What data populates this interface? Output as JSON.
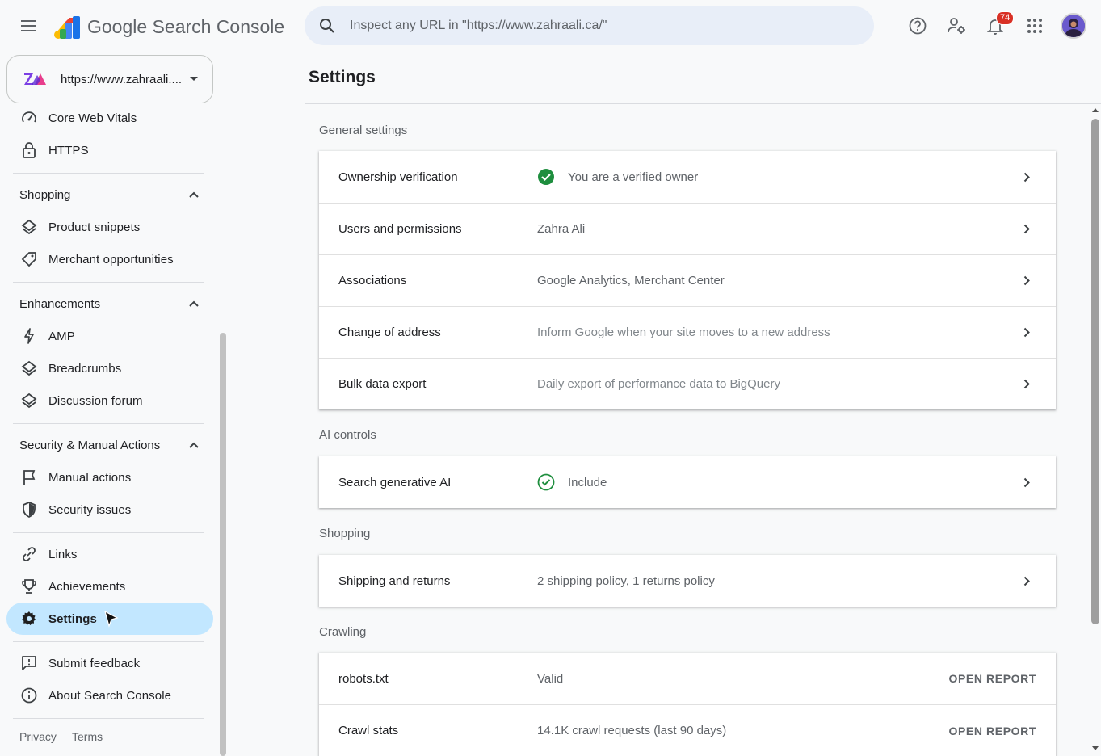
{
  "header": {
    "app_name": "Google Search Console",
    "search_placeholder": "Inspect any URL in \"https://www.zahraali.ca/\"",
    "notification_count": "74"
  },
  "property": {
    "url": "https://www.zahraali...."
  },
  "sidebar": {
    "items_top": [
      {
        "label": "Core Web Vitals",
        "icon": "gauge-icon"
      },
      {
        "label": "HTTPS",
        "icon": "lock-icon"
      }
    ],
    "sections": [
      {
        "title": "Shopping",
        "items": [
          "Product snippets",
          "Merchant opportunities"
        ]
      },
      {
        "title": "Enhancements",
        "items": [
          "AMP",
          "Breadcrumbs",
          "Discussion forum"
        ]
      },
      {
        "title": "Security & Manual Actions",
        "items": [
          "Manual actions",
          "Security issues"
        ]
      }
    ],
    "items_bottom": [
      "Links",
      "Achievements",
      "Settings"
    ],
    "active_item": "Settings",
    "footer_items": [
      "Submit feedback",
      "About Search Console"
    ],
    "footer_links": {
      "privacy": "Privacy",
      "terms": "Terms"
    }
  },
  "main": {
    "title": "Settings",
    "groups": [
      {
        "label": "General settings",
        "rows": [
          {
            "label": "Ownership verification",
            "value": "You are a verified owner",
            "icon": "verified-check-icon"
          },
          {
            "label": "Users and permissions",
            "value": "Zahra Ali"
          },
          {
            "label": "Associations",
            "value": "Google Analytics, Merchant Center"
          },
          {
            "label": "Change of address",
            "value": "Inform Google when your site moves to a new address"
          },
          {
            "label": "Bulk data export",
            "value": "Daily export of performance data to BigQuery"
          }
        ]
      },
      {
        "label": "AI controls",
        "rows": [
          {
            "label": "Search generative AI",
            "value": "Include",
            "icon": "outline-check-icon"
          }
        ]
      },
      {
        "label": "Shopping",
        "rows": [
          {
            "label": "Shipping and returns",
            "value": "2 shipping policy, 1 returns policy"
          }
        ]
      },
      {
        "label": "Crawling",
        "rows": [
          {
            "label": "robots.txt",
            "value": "Valid",
            "action": "OPEN REPORT"
          },
          {
            "label": "Crawl stats",
            "value": "14.1K crawl requests (last 90 days)",
            "action": "OPEN REPORT"
          }
        ]
      }
    ]
  },
  "colors": {
    "accent": "#1a73e8",
    "active_nav": "#c2e7ff",
    "verified": "#1e8e3e",
    "badge": "#d93025"
  }
}
